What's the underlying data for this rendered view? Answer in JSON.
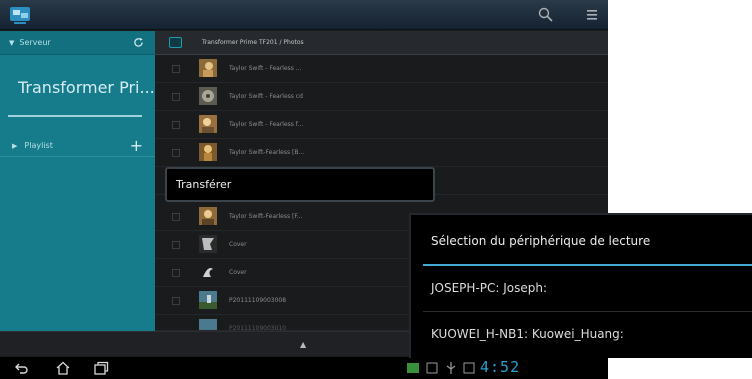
{
  "header": {
    "app_icon": "media-server-icon",
    "search_icon": "search-icon",
    "menu_icon": "menu-icon"
  },
  "sidebar": {
    "server_label": "Serveur",
    "server_name": "Transformer Pri...",
    "playlist_label": "Playlist",
    "add_label": "+"
  },
  "main": {
    "path": "Transformer Prime TF201 / Photos",
    "rows": [
      {
        "label": "Taylor Swift - Fearless ..."
      },
      {
        "label": "Taylor Swift - Fearless  cd"
      },
      {
        "label": "Taylor Swift - Fearless  f..."
      },
      {
        "label": "Taylor Swift-Fearless [B..."
      },
      {
        "label": ""
      },
      {
        "label": "Taylor Swift-Fearless [F..."
      },
      {
        "label": "Cover"
      },
      {
        "label": "Cover"
      },
      {
        "label": "P20111109003008"
      },
      {
        "label": "P20111109003010"
      }
    ]
  },
  "context_menu": {
    "item": "Transférer"
  },
  "dialog": {
    "title": "Sélection du périphérique de lecture",
    "devices": [
      {
        "label": "JOSEPH-PC: Joseph:"
      },
      {
        "label": "KUOWEI_H-NB1: Kuowei_Huang:"
      }
    ]
  },
  "system_bar": {
    "clock": "4:52"
  },
  "colors": {
    "accent": "#43a8d6",
    "sidebar": "#167c8c"
  }
}
